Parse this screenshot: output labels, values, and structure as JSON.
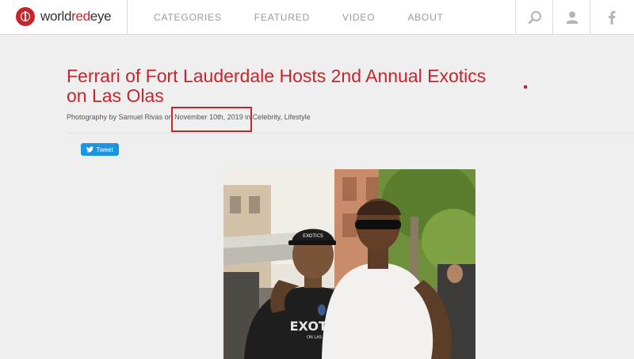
{
  "header": {
    "logo_prefix": "world",
    "logo_highlight": "red",
    "logo_suffix": "eye",
    "nav": [
      "CATEGORIES",
      "FEATURED",
      "VIDEO",
      "ABOUT"
    ],
    "icons": [
      "search-icon",
      "user-icon",
      "facebook-icon"
    ]
  },
  "article": {
    "title": "Ferrari of Fort Lauderdale Hosts 2nd Annual Exotics on Las Olas",
    "byline_prefix": "Photography by Samuel Rivas on",
    "date": "November 10th, 2019",
    "byline_in": "in",
    "category_1": "Celebrity",
    "category_sep": ",",
    "category_2": "Lifestyle",
    "tweet_label": "Tweet"
  },
  "photo": {
    "cap_text": "EXOTICS",
    "shirt_text": "EXOTICS",
    "shirt_subtext": "ON LAS OLAS"
  },
  "colors": {
    "brand_red": "#c6252b",
    "twitter_blue": "#1b95e0",
    "page_bg": "#efefef"
  }
}
